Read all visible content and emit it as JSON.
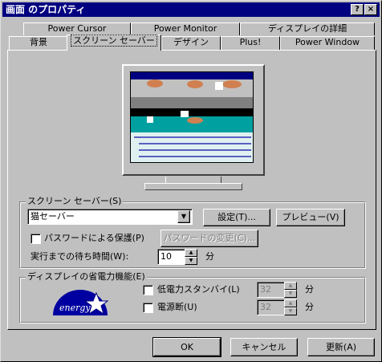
{
  "window": {
    "title": "画面 のプロパティ",
    "help_btn": "?",
    "close_btn": "×"
  },
  "tabs_row1": [
    "Power Cursor",
    "Power Monitor",
    "ディスプレイの詳細"
  ],
  "tabs_row2": [
    "背景",
    "スクリーン セーバー",
    "デザイン",
    "Plus!",
    "Power Window"
  ],
  "active_tab": "スクリーン セーバー",
  "preview": {
    "screen_lines": [
      "Power Cursor -- Mouse",
      "Screen Saver",
      "Generating Power..."
    ]
  },
  "screensaver": {
    "group_label": "スクリーン セーバー(S)",
    "selected": "猫セーバー",
    "settings_btn": "設定(T)...",
    "preview_btn": "プレビュー(V)",
    "password_label": "パスワードによる保護(P)",
    "password_checked": false,
    "change_password_btn": "パスワードの変更(C)...",
    "wait_label": "実行までの待ち時間(W):",
    "wait_value": "10",
    "wait_unit": "分"
  },
  "power": {
    "group_label": "ディスプレイの省電力機能(E)",
    "logo_text": "energy",
    "standby_label": "低電力スタンバイ(L)",
    "standby_checked": false,
    "standby_value": "32",
    "standby_unit": "分",
    "off_label": "電源断(U)",
    "off_checked": false,
    "off_value": "32",
    "off_unit": "分"
  },
  "buttons": {
    "ok": "OK",
    "cancel": "キャンセル",
    "apply": "更新(A)"
  },
  "colors": {
    "titlebar": "#000080",
    "face": "#c0c0c0",
    "desktop": "#008080"
  }
}
